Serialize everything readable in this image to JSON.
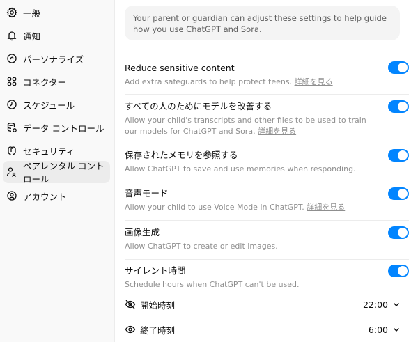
{
  "sidebar": {
    "items": [
      {
        "label": "一般"
      },
      {
        "label": "通知"
      },
      {
        "label": "パーソナライズ"
      },
      {
        "label": "コネクター"
      },
      {
        "label": "スケジュール"
      },
      {
        "label": "データ コントロール"
      },
      {
        "label": "セキュリティ"
      },
      {
        "label": "ペアレンタル コントロール"
      },
      {
        "label": "アカウント"
      }
    ]
  },
  "notice": "Your parent or guardian can adjust these settings to help guide how you use ChatGPT and Sora.",
  "settings": [
    {
      "title": "Reduce sensitive content",
      "desc": "Add extra safeguards to help protect teens.",
      "link": "詳細を見る",
      "enabled": true
    },
    {
      "title": "すべての人のためにモデルを改善する",
      "desc": "Allow your child's transcripts and other files to be used to train our models for ChatGPT and Sora.",
      "link": "詳細を見る",
      "enabled": true
    },
    {
      "title": "保存されたメモリを参照する",
      "desc": "Allow ChatGPT to save and use memories when responding.",
      "enabled": true
    },
    {
      "title": "音声モード",
      "desc": "Allow your child to use Voice Mode in ChatGPT.",
      "link": "詳細を見る",
      "enabled": true
    },
    {
      "title": "画像生成",
      "desc": "Allow ChatGPT to create or edit images.",
      "enabled": true
    },
    {
      "title": "サイレント時間",
      "desc": "Schedule hours when ChatGPT can't be used.",
      "enabled": true
    }
  ],
  "quiet_hours": {
    "start_label": "開始時刻",
    "start_value": "22:00",
    "end_label": "終了時刻",
    "end_value": "6:00"
  },
  "colors": {
    "accent": "#0285ff",
    "sidebar_bg": "#f9f9f9",
    "active_bg": "#ececec"
  }
}
